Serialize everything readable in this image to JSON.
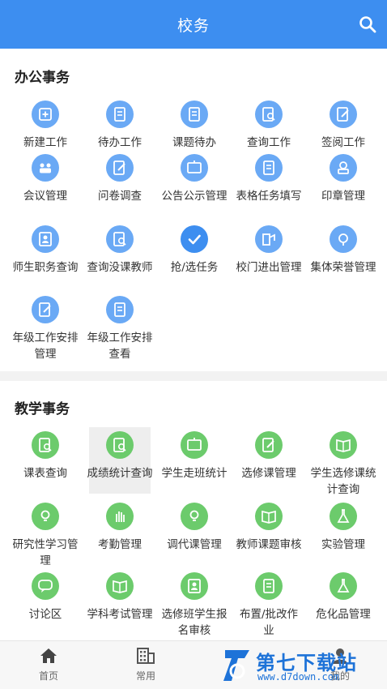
{
  "header": {
    "title": "校务"
  },
  "sections": [
    {
      "title": "办公事务",
      "items": [
        {
          "label": "新建工作",
          "icon": "new-work-icon"
        },
        {
          "label": "待办工作",
          "icon": "todo-work-icon"
        },
        {
          "label": "课题待办",
          "icon": "topic-todo-icon"
        },
        {
          "label": "查询工作",
          "icon": "query-work-icon"
        },
        {
          "label": "签阅工作",
          "icon": "sign-read-icon"
        },
        {
          "label": "会议管理",
          "icon": "meeting-icon"
        },
        {
          "label": "问卷调查",
          "icon": "survey-icon"
        },
        {
          "label": "公告公示管理",
          "icon": "notice-icon"
        },
        {
          "label": "表格任务填写",
          "icon": "form-task-icon"
        },
        {
          "label": "印章管理",
          "icon": "seal-icon"
        },
        {
          "label": "师生职务查询",
          "icon": "duty-query-icon"
        },
        {
          "label": "查询没课教师",
          "icon": "free-teacher-icon"
        },
        {
          "label": "抢/选任务",
          "icon": "check-icon"
        },
        {
          "label": "校门进出管理",
          "icon": "gate-icon"
        },
        {
          "label": "集体荣誉管理",
          "icon": "honor-icon"
        },
        {
          "label": "年级工作安排管理",
          "icon": "grade-plan-icon"
        },
        {
          "label": "年级工作安排查看",
          "icon": "grade-view-icon"
        }
      ]
    },
    {
      "title": "教学事务",
      "items": [
        {
          "label": "课表查询",
          "icon": "schedule-icon"
        },
        {
          "label": "成绩统计查询",
          "icon": "score-icon"
        },
        {
          "label": "学生走班统计",
          "icon": "class-move-icon"
        },
        {
          "label": "选修课管理",
          "icon": "elective-icon"
        },
        {
          "label": "学生选修课统计查询",
          "icon": "elective-stat-icon"
        },
        {
          "label": "研究性学习管理",
          "icon": "research-icon"
        },
        {
          "label": "考勤管理",
          "icon": "attendance-icon"
        },
        {
          "label": "调代课管理",
          "icon": "substitute-icon"
        },
        {
          "label": "教师课题审核",
          "icon": "topic-review-icon"
        },
        {
          "label": "实验管理",
          "icon": "lab-icon"
        },
        {
          "label": "讨论区",
          "icon": "discussion-icon"
        },
        {
          "label": "学科考试管理",
          "icon": "exam-icon"
        },
        {
          "label": "选修班学生报名审核",
          "icon": "signup-review-icon"
        },
        {
          "label": "布置/批改作业",
          "icon": "homework-icon"
        },
        {
          "label": "危化品管理",
          "icon": "chemical-icon"
        }
      ]
    }
  ],
  "tabs": [
    {
      "label": "首页",
      "icon": "home-icon"
    },
    {
      "label": "常用",
      "icon": "building-icon"
    },
    {
      "label": "我的",
      "icon": "user-icon"
    }
  ],
  "watermark": {
    "text": "第七下载站",
    "url": "www.d7down.com"
  },
  "colors": {
    "primary": "#3d8ef0",
    "office_icon": "#6aa9f5",
    "teaching_icon": "#6ccb6c"
  }
}
